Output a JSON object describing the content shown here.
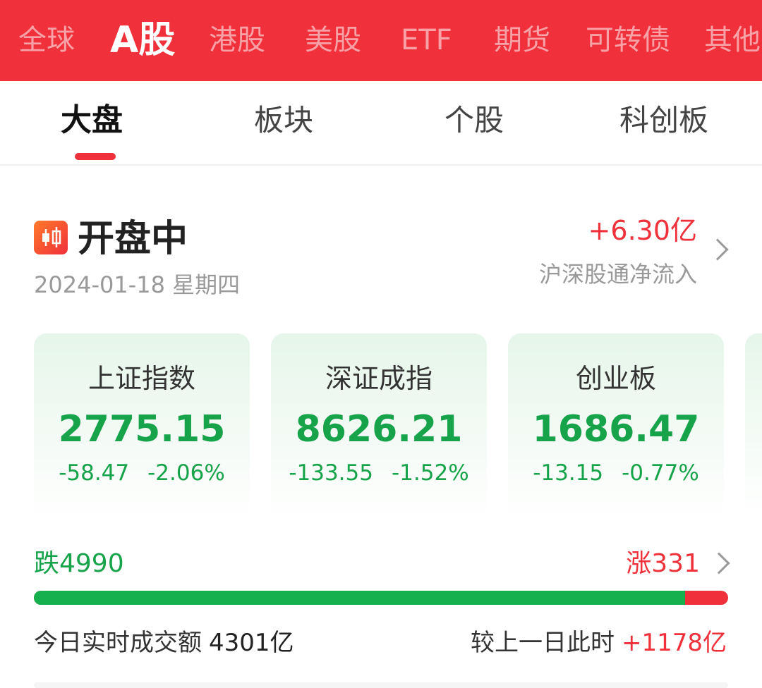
{
  "market_tabs": [
    {
      "label": "全球",
      "active": false
    },
    {
      "label": "A股",
      "active": true
    },
    {
      "label": "港股",
      "active": false
    },
    {
      "label": "美股",
      "active": false
    },
    {
      "label": "ETF",
      "active": false
    },
    {
      "label": "期货",
      "active": false
    },
    {
      "label": "可转债",
      "active": false
    },
    {
      "label": "其他",
      "active": false
    }
  ],
  "sub_tabs": [
    {
      "label": "大盘",
      "active": true
    },
    {
      "label": "板块",
      "active": false
    },
    {
      "label": "个股",
      "active": false
    },
    {
      "label": "科创板",
      "active": false
    }
  ],
  "status": {
    "icon": "candlestick-icon",
    "title": "开盘中",
    "date": "2024-01-18 星期四",
    "flow_value": "+6.30亿",
    "flow_label": "沪深股通净流入"
  },
  "indices": [
    {
      "name": "上证指数",
      "value": "2775.15",
      "change": "-58.47",
      "change_pct": "-2.06%"
    },
    {
      "name": "深证成指",
      "value": "8626.21",
      "change": "-133.55",
      "change_pct": "-1.52%"
    },
    {
      "name": "创业板",
      "value": "1686.47",
      "change": "-13.15",
      "change_pct": "-0.77%"
    }
  ],
  "breadth": {
    "fall_label": "跌4990",
    "rise_label": "涨331",
    "fall_count": 4990,
    "rise_count": 331
  },
  "turnover": {
    "label": "今日实时成交额",
    "amount": "4301亿",
    "compare_label": "较上一日此时",
    "compare_amount": "+1178亿"
  },
  "colors": {
    "accent_red": "#f0303a",
    "down_green": "#16a34a"
  }
}
